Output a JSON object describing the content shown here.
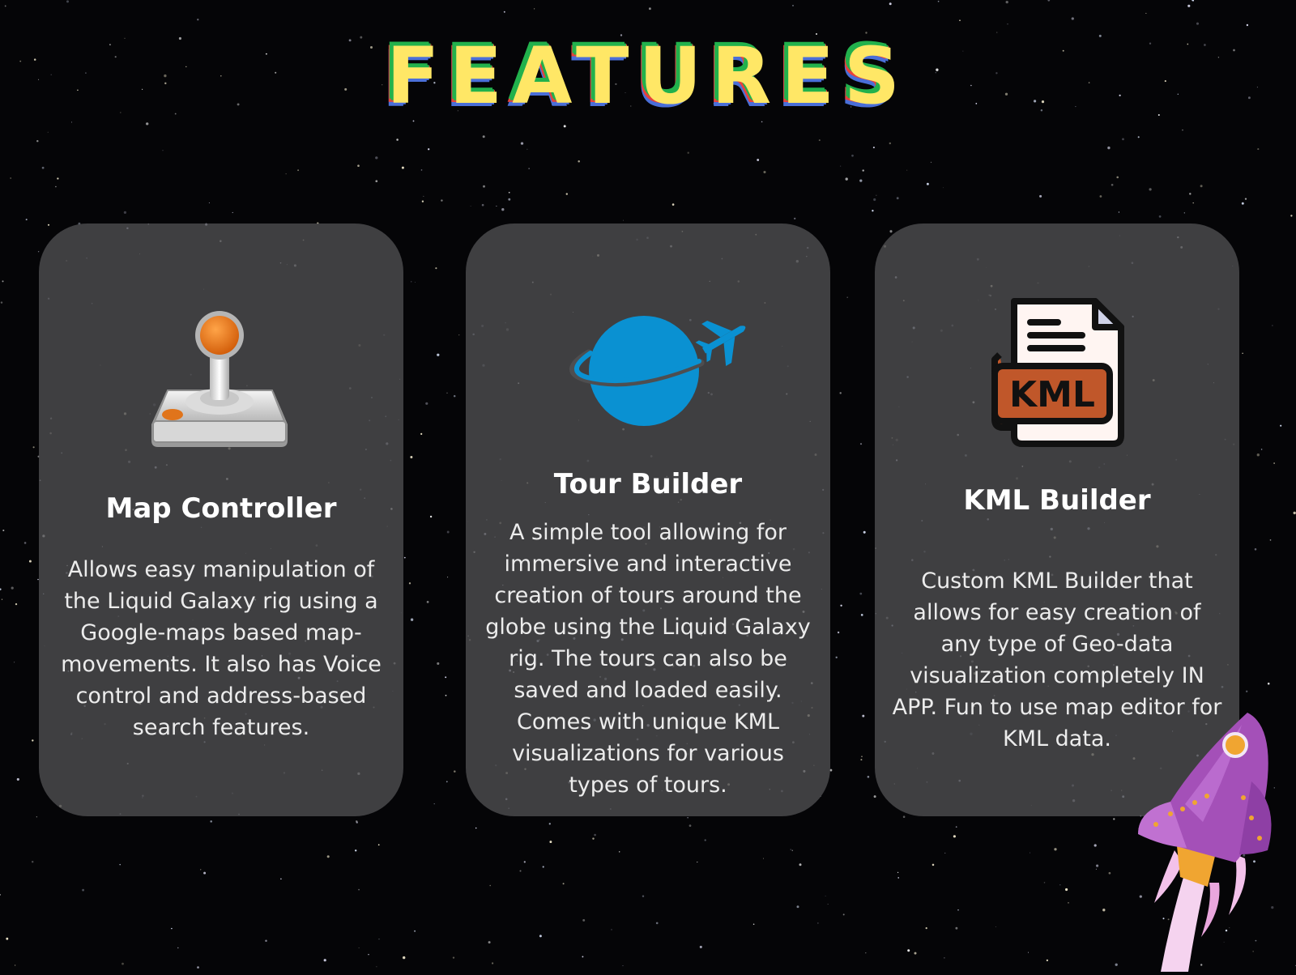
{
  "title": "FEATURES",
  "cards": [
    {
      "title": "Map Controller",
      "description": "Allows easy manipulation of the Liquid Galaxy rig using a Google-maps based map-movements. It also has Voice control and address-based search features.",
      "icon": "joystick-icon"
    },
    {
      "title": "Tour Builder",
      "description": "A simple tool allowing for immersive and interactive creation of tours around the globe using the Liquid Galaxy rig. The tours can also be saved and loaded easily. Comes with unique KML visualizations for various types of tours.",
      "icon": "globe-plane-icon"
    },
    {
      "title": "KML Builder",
      "description": "Custom KML Builder that allows for easy creation of any type of Geo-data visualization completely IN APP. Fun to use map editor for KML data.",
      "icon": "kml-file-icon",
      "icon_label": "KML"
    }
  ],
  "colors": {
    "background": "#050507",
    "card": "#4e4e50",
    "title_fill": "#ffe766",
    "title_green": "#22b14c",
    "title_red": "#e8413b",
    "title_blue": "#4a6fd8",
    "joystick_knob": "#ef7a1a",
    "globe": "#0a91d2",
    "kml_badge": "#c0572a",
    "rocket": "#a450b8"
  }
}
